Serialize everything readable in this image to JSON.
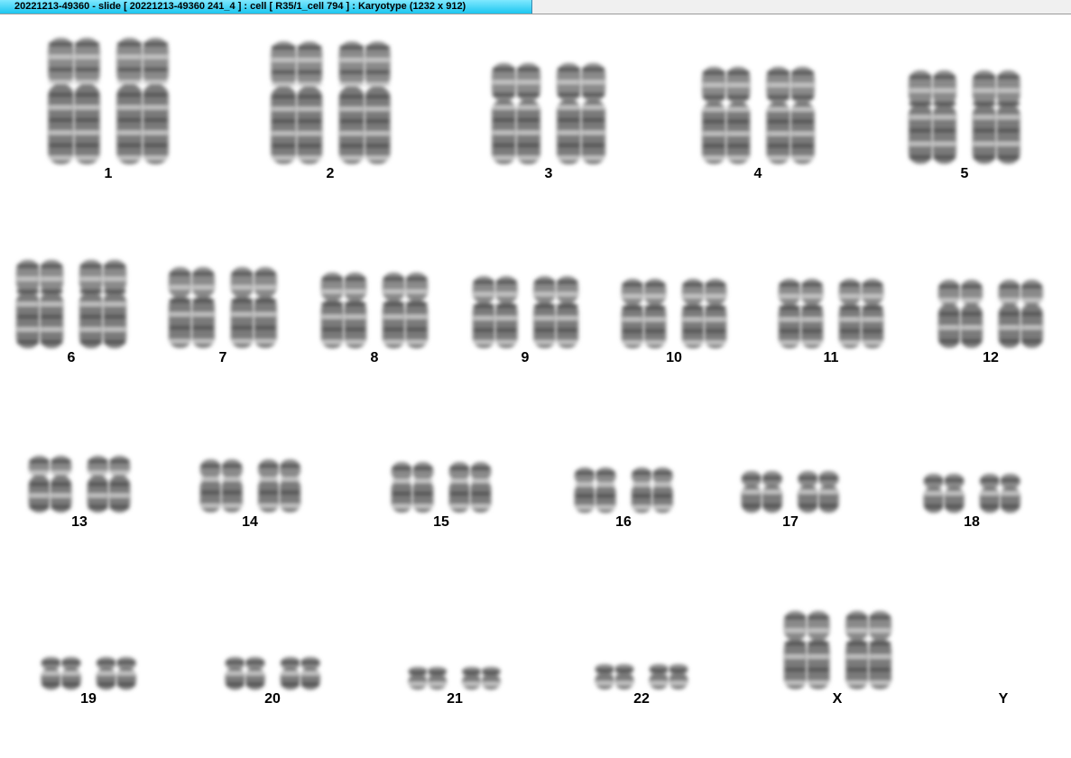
{
  "window": {
    "title": "20221213-49360 - slide [ 20221213-49360 241_4 ] : cell [ R35/1_cell 794 ] : Karyotype  (1232 x 912)"
  },
  "karyotype": {
    "chromosomes": [
      {
        "label": "1",
        "present": true,
        "size": 1.0
      },
      {
        "label": "2",
        "present": true,
        "size": 0.97
      },
      {
        "label": "3",
        "present": true,
        "size": 0.8
      },
      {
        "label": "4",
        "present": true,
        "size": 0.77
      },
      {
        "label": "5",
        "present": true,
        "size": 0.74
      },
      {
        "label": "6",
        "present": true,
        "size": 0.7
      },
      {
        "label": "7",
        "present": true,
        "size": 0.64
      },
      {
        "label": "8",
        "present": true,
        "size": 0.6
      },
      {
        "label": "9",
        "present": true,
        "size": 0.57
      },
      {
        "label": "10",
        "present": true,
        "size": 0.55
      },
      {
        "label": "11",
        "present": true,
        "size": 0.55
      },
      {
        "label": "12",
        "present": true,
        "size": 0.54
      },
      {
        "label": "13",
        "present": true,
        "size": 0.45
      },
      {
        "label": "14",
        "present": true,
        "size": 0.42
      },
      {
        "label": "15",
        "present": true,
        "size": 0.4
      },
      {
        "label": "16",
        "present": true,
        "size": 0.36
      },
      {
        "label": "17",
        "present": true,
        "size": 0.33
      },
      {
        "label": "18",
        "present": true,
        "size": 0.31
      },
      {
        "label": "19",
        "present": true,
        "size": 0.26
      },
      {
        "label": "20",
        "present": true,
        "size": 0.26
      },
      {
        "label": "21",
        "present": true,
        "size": 0.18
      },
      {
        "label": "22",
        "present": true,
        "size": 0.2
      },
      {
        "label": "X",
        "present": true,
        "size": 0.62
      },
      {
        "label": "Y",
        "present": false,
        "size": 0
      }
    ]
  }
}
